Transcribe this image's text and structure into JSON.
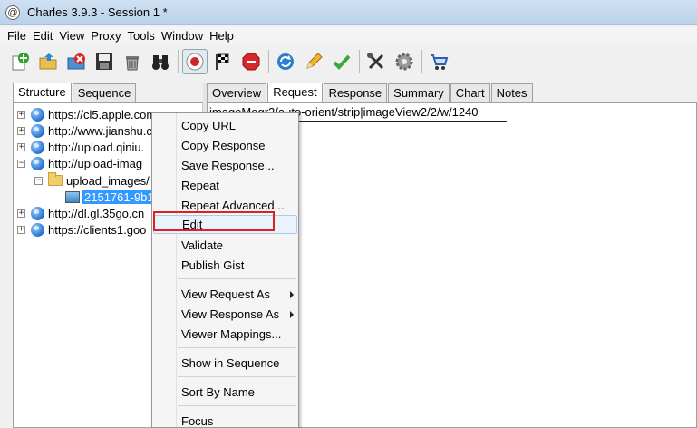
{
  "window": {
    "icon_glyph": "@",
    "title": "Charles 3.9.3 - Session 1 *"
  },
  "menubar": [
    "File",
    "Edit",
    "View",
    "Proxy",
    "Tools",
    "Window",
    "Help"
  ],
  "toolbar": {
    "buttons": [
      "add-icon",
      "open-icon",
      "delete-icon",
      "save-icon",
      "trash-icon",
      "binoculars-icon",
      "record-icon",
      "checkered-flag-icon",
      "stop-icon",
      "refresh-icon",
      "pencil-icon",
      "checkmark-icon",
      "tools-icon",
      "gear-icon",
      "shopping-cart-icon"
    ],
    "record_pressed": true
  },
  "left_tabs": [
    "Structure",
    "Sequence"
  ],
  "left_tabs_active": "Structure",
  "tree": [
    {
      "label": "https://cl5.apple.com",
      "expander": "+"
    },
    {
      "label": "http://www.jianshu.c",
      "expander": "+"
    },
    {
      "label": "http://upload.qiniu.",
      "expander": "+"
    },
    {
      "label": "http://upload-imag",
      "expander": "−"
    },
    {
      "label": "upload_images/",
      "expander": "−"
    },
    {
      "label": "2151761-9b1"
    },
    {
      "label": "http://dl.gl.35go.cn",
      "expander": "+"
    },
    {
      "label": "https://clients1.goo",
      "expander": "+"
    }
  ],
  "right_tabs": [
    "Overview",
    "Request",
    "Response",
    "Summary",
    "Chart",
    "Notes"
  ],
  "right_tabs_active": "Request",
  "request_line": "imageMogr2/auto-orient/strip|imageView2/2/w/1240",
  "context_menu": {
    "items": [
      "Copy URL",
      "Copy Response",
      "Save Response...",
      "Repeat",
      "Repeat Advanced...",
      "Edit",
      "Validate",
      "Publish Gist",
      "View Request As",
      "View Response As",
      "Viewer Mappings...",
      "Show in Sequence",
      "Sort By Name",
      "Focus"
    ],
    "highlighted": "Edit"
  },
  "colors": {
    "selection": "#3399ff",
    "highlight_box": "#e02020"
  }
}
